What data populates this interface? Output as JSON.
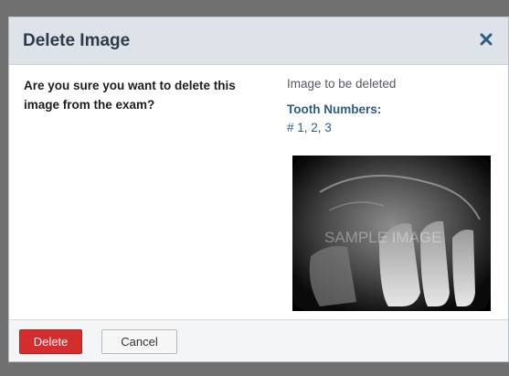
{
  "modal": {
    "title": "Delete Image",
    "close_icon": "close-icon"
  },
  "body": {
    "question": "Are you sure you want to delete this image from the exam?",
    "image_caption": "Image to be deleted",
    "tooth_label": "Tooth Numbers:",
    "tooth_values": "# 1, 2, 3",
    "watermark": "SAMPLE IMAGE"
  },
  "footer": {
    "delete_label": "Delete",
    "cancel_label": "Cancel"
  },
  "colors": {
    "header_bg": "#dde3e8",
    "accent_blue": "#2b5b86",
    "delete_red": "#d42d2e"
  }
}
